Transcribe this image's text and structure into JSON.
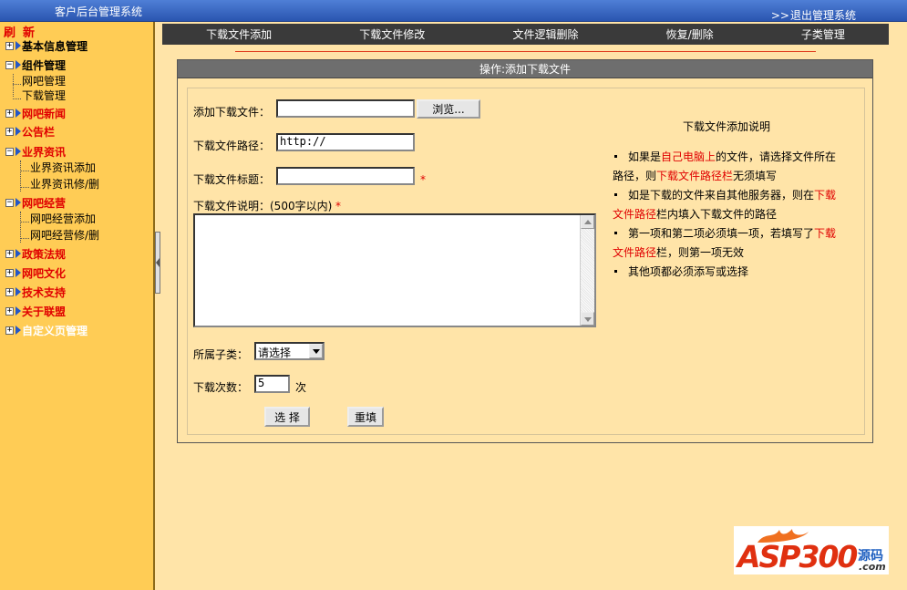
{
  "header": {
    "title": "客户后台管理系统",
    "logout_label": "退出管理系统",
    "logout_prefix": ">>"
  },
  "sidebar": {
    "refresh_label": "刷新",
    "items": [
      {
        "label": "基本信息管理",
        "expanded": false
      },
      {
        "label": "组件管理",
        "expanded": true,
        "children": [
          "网吧管理",
          "下载管理"
        ]
      },
      {
        "label": "网吧新闻",
        "expanded": false
      },
      {
        "label": "公告栏",
        "expanded": false
      },
      {
        "label": "业界资讯",
        "expanded": true,
        "children": [
          "业界资讯添加",
          "业界资讯修/删"
        ]
      },
      {
        "label": "网吧经营",
        "expanded": true,
        "children": [
          "网吧经营添加",
          "网吧经营修/删"
        ]
      },
      {
        "label": "政策法规",
        "expanded": false
      },
      {
        "label": "网吧文化",
        "expanded": false
      },
      {
        "label": "技术支持",
        "expanded": false
      },
      {
        "label": "关于联盟",
        "expanded": false
      },
      {
        "label": "自定义页管理",
        "expanded": false
      }
    ]
  },
  "tabs": [
    "下载文件添加",
    "下载文件修改",
    "文件逻辑删除",
    "恢复/删除",
    "子类管理"
  ],
  "panel": {
    "title": "操作:添加下载文件",
    "form": {
      "file_label": "添加下载文件：",
      "browse_label": "浏览...",
      "path_label": "下载文件路径：",
      "path_value": "http://",
      "title_label": "下载文件标题：",
      "desc_label": "下载文件说明：(500字以内)",
      "required_mark": "*",
      "category_label": "所属子类：",
      "category_value": "请选择",
      "count_label": "下载次数：",
      "count_value": "5",
      "count_unit": "次",
      "select_btn": "选 择",
      "reset_btn": "重填"
    },
    "help": {
      "title": "下载文件添加说明",
      "notes": [
        [
          "如果是",
          "自己电脑上",
          "的文件，请选择文件所在路径，则",
          "下载文件路径栏",
          "无须填写"
        ],
        [
          "如是下载的文件来自其他服务器，则在",
          "下载文件路径",
          "栏内填入下载文件的路径"
        ],
        [
          "第一项和第二项必须填一项，若填写了",
          "下载文件路径",
          "栏，则第一项无效"
        ],
        [
          "其他项都必须添写或选择"
        ]
      ]
    }
  },
  "logo": {
    "main": "ASP300",
    "sub1": "源码",
    "sub2": ".com"
  },
  "colors": {
    "accent_red": "#e00000",
    "sidebar_bg": "#ffcc55",
    "page_bg": "#ffe4a8",
    "tabbar_bg": "#3a3a3a",
    "header_blue": "#2a55b0"
  }
}
